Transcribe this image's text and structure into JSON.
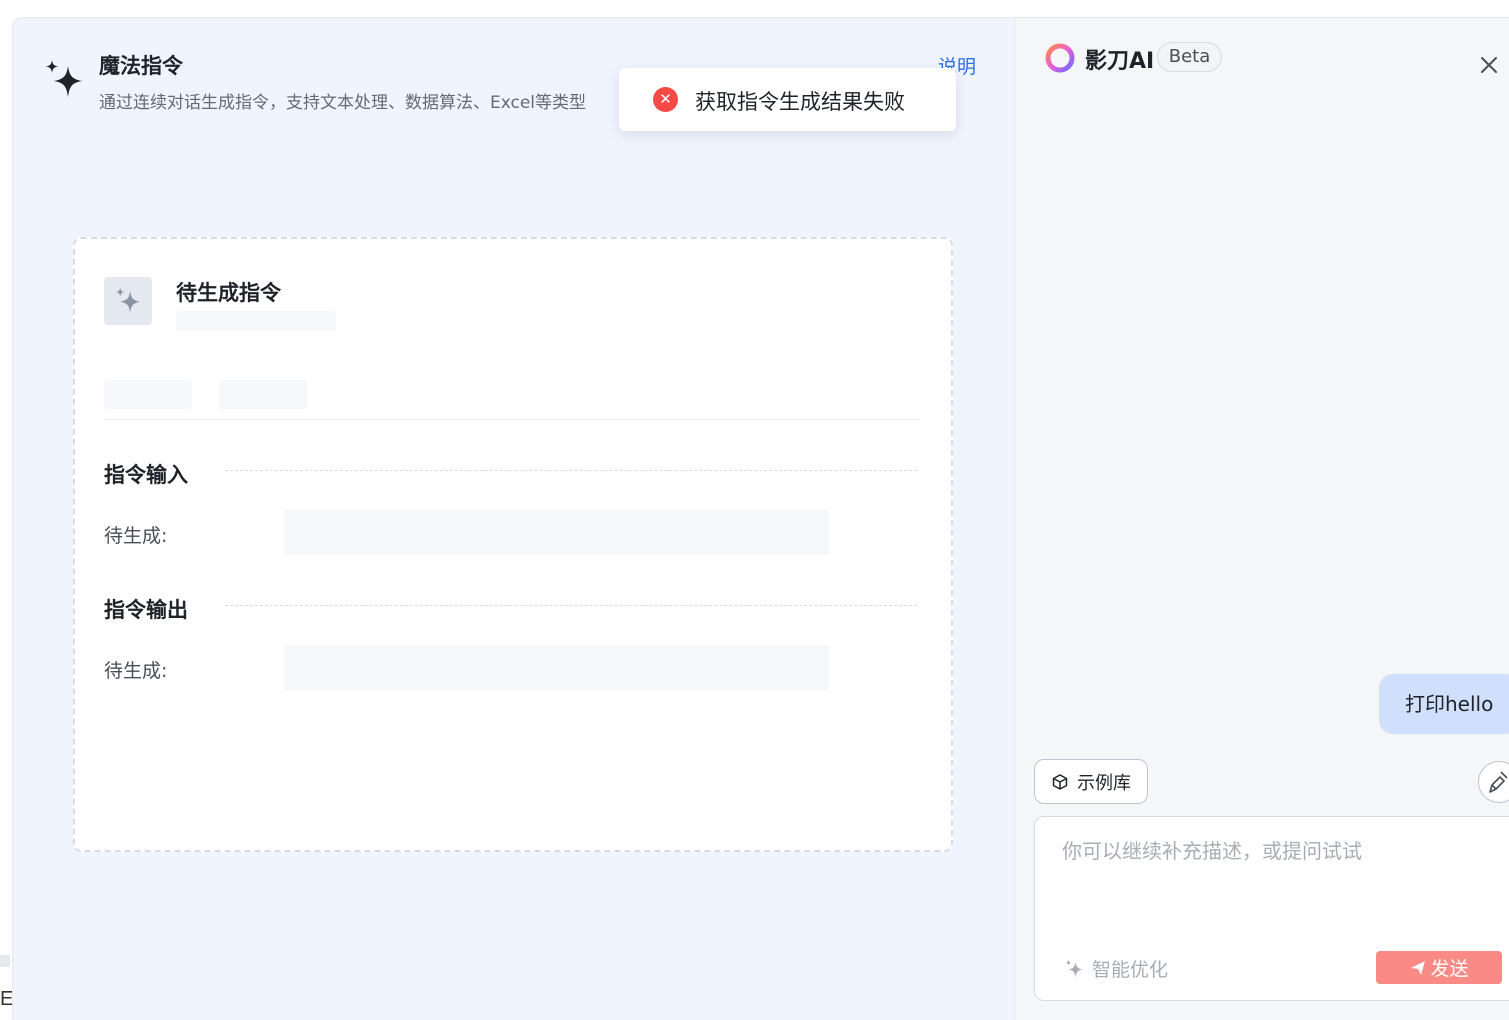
{
  "edge": {
    "letter": "E"
  },
  "header": {
    "title": "魔法指令",
    "subtitle": "通过连续对话生成指令，支持文本处理、数据算法、Excel等类型",
    "help_link": "说明"
  },
  "toast": {
    "message": "获取指令生成结果失败",
    "icon": "error-circle-icon",
    "color": "#f54a45"
  },
  "card": {
    "title": "待生成指令",
    "sections": [
      {
        "title": "指令输入",
        "field_label": "待生成:"
      },
      {
        "title": "指令输出",
        "field_label": "待生成:"
      }
    ]
  },
  "assistant": {
    "name": "影刀AI",
    "badge": "Beta",
    "close_icon": "close-icon"
  },
  "chat": {
    "messages": [
      {
        "role": "user",
        "text": "打印hello"
      }
    ]
  },
  "composer": {
    "examples_label": "示例库",
    "placeholder": "你可以继续补充描述，或提问试试",
    "optimize_label": "智能优化",
    "send_label": "发送",
    "send_color": "#f98a85"
  }
}
